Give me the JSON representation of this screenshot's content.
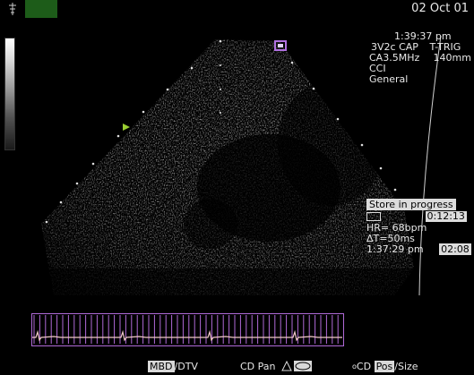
{
  "header": {
    "date": "02 Oct 01"
  },
  "settings": {
    "time": "1:39:37 pm",
    "probe": "3V2c CAP",
    "trigger": "T-TRIG",
    "frequency": "CA3.5MHz",
    "depth": "140mm",
    "mode": "CCI",
    "preset": "General"
  },
  "store": {
    "status": "Store in progress",
    "timer": "0:12:13",
    "hr": "HR=  68bpm",
    "delta_t": "ΔT=50ms",
    "clock": "1:37:29 pm",
    "clip": "02:08"
  },
  "bottom_bar": {
    "mbd_box": "MBD",
    "dtv": "/DTV",
    "cd_pan": "CD Pan",
    "cd_label": "CD",
    "pos_box": "Pos",
    "size": "/Size"
  },
  "colors": {
    "accent_green": "#1d5c19",
    "ecg_trace": "#f0c8c8",
    "ecg_ticks": "#b06ad8",
    "marker": "#b070e0"
  }
}
